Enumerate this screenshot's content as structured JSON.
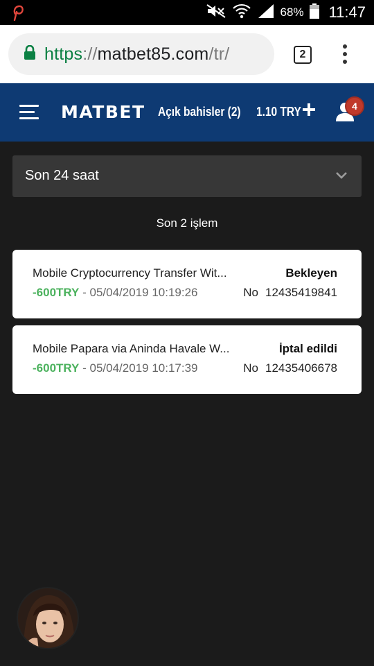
{
  "status_bar": {
    "battery_percent": "68%",
    "time": "11:47"
  },
  "browser": {
    "url_scheme": "https",
    "url_sep": "://",
    "url_host": "matbet85.com",
    "url_path": "/tr/",
    "tab_count": "2"
  },
  "header": {
    "logo": "MATBET",
    "open_bets": "Açık bahisler (2)",
    "balance": "1.10 TRY",
    "notification_count": "4"
  },
  "filter": {
    "selected": "Son 24 saat"
  },
  "summary": "Son 2 işlem",
  "transactions": [
    {
      "title": "Mobile Cryptocurrency Transfer Wit...",
      "status": "Bekleyen",
      "amount": "-600TRY",
      "separator": " - ",
      "datetime": "05/04/2019 10:19:26",
      "no_label": "No",
      "number": "12435419841"
    },
    {
      "title": "Mobile Papara via Aninda Havale W...",
      "status": "İptal edildi",
      "amount": "-600TRY",
      "separator": " - ",
      "datetime": "05/04/2019 10:17:39",
      "no_label": "No",
      "number": "12435406678"
    }
  ],
  "colors": {
    "header_bg": "#0e3a73",
    "page_bg": "#1b1b1b",
    "amount": "#4cb25e",
    "badge": "#c0392b",
    "secure": "#0b8043"
  },
  "icons": [
    "pinterest-icon",
    "mute-icon",
    "wifi-icon",
    "signal-icon",
    "battery-icon",
    "lock-icon",
    "tabs-icon",
    "overflow-menu-icon",
    "hamburger-menu-icon",
    "plus-icon",
    "user-icon",
    "chevron-down-icon"
  ]
}
